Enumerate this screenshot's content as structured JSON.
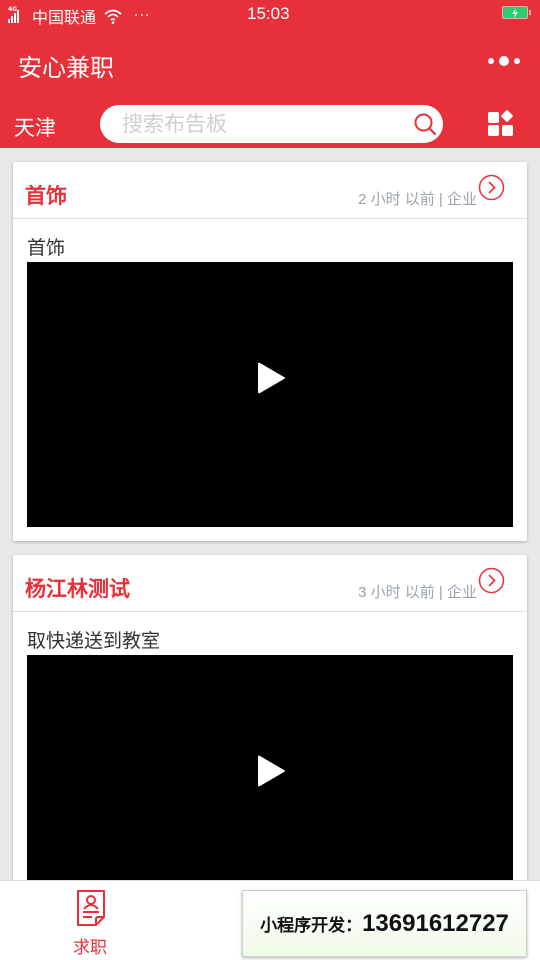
{
  "status_bar": {
    "network_type": "4G",
    "carrier": "中国联通",
    "more": "···",
    "time": "15:03",
    "battery_state": "charging"
  },
  "nav_bar": {
    "title": "安心兼职",
    "more_icon": "capsule-more-icon"
  },
  "search_row": {
    "city": "天津",
    "search_placeholder": "搜索布告板",
    "search_value": "",
    "search_icon": "search-icon",
    "category_icon": "grid-icon"
  },
  "posts": [
    {
      "title": "首饰",
      "meta": "2 小时 以前 | 企业",
      "description": "首饰",
      "has_video": true
    },
    {
      "title": "杨江林测试",
      "meta": "3 小时 以前 | 企业",
      "description": "取快递送到教室",
      "has_video": true
    }
  ],
  "tab_bar": {
    "tabs": [
      {
        "label": "求职",
        "icon": "resume-icon",
        "active": true
      },
      {
        "label": "",
        "icon": "circle-icon",
        "active": false
      },
      {
        "label": "",
        "icon": "message-icon",
        "active": false
      }
    ]
  },
  "promo_overlay": {
    "label": "小程序开发：",
    "phone": "13691612727"
  },
  "colors": {
    "brand_red": "#e8303a",
    "meta_gray": "#9aa3ad",
    "page_bg": "#e9e8e6",
    "battery_green": "#2ecc71"
  }
}
